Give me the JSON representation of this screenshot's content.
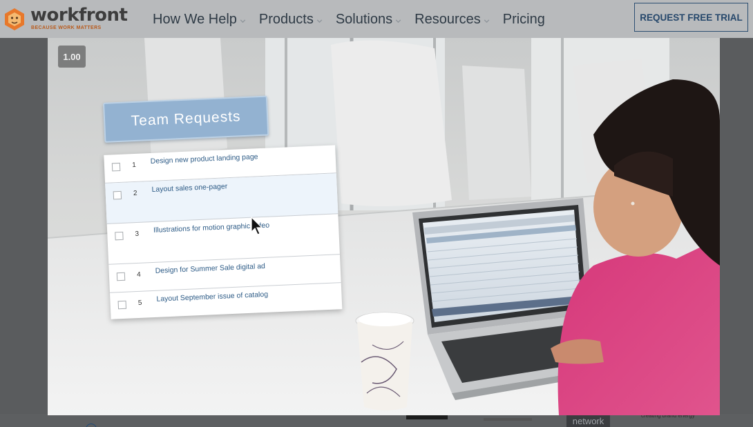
{
  "header": {
    "logo_word": "workfront",
    "logo_tagline": "BECAUSE WORK MATTERS",
    "nav": [
      {
        "label": "How We Help",
        "has_menu": true
      },
      {
        "label": "Products",
        "has_menu": true
      },
      {
        "label": "Solutions",
        "has_menu": true
      },
      {
        "label": "Resources",
        "has_menu": true
      },
      {
        "label": "Pricing",
        "has_menu": false
      }
    ],
    "cta_label": "REQUEST FREE TRIAL"
  },
  "video": {
    "playback_speed": "1.00",
    "card_title": "Team Requests",
    "tasks": [
      {
        "num": "1",
        "title": "Design new product landing page"
      },
      {
        "num": "2",
        "title": "Layout sales one-pager"
      },
      {
        "num": "3",
        "title": "Illustrations for motion graphic video"
      },
      {
        "num": "4",
        "title": "Design for Summer Sale digital ad"
      },
      {
        "num": "5",
        "title": "Layout September issue of catalog"
      }
    ]
  },
  "footer_fragments": {
    "badge": "network",
    "tagline": "creating brand energy"
  },
  "colors": {
    "brand_orange": "#e7782b",
    "cta_border": "#2c4f72",
    "card_blue": "#93b2d1",
    "task_text": "#2d5b86"
  }
}
